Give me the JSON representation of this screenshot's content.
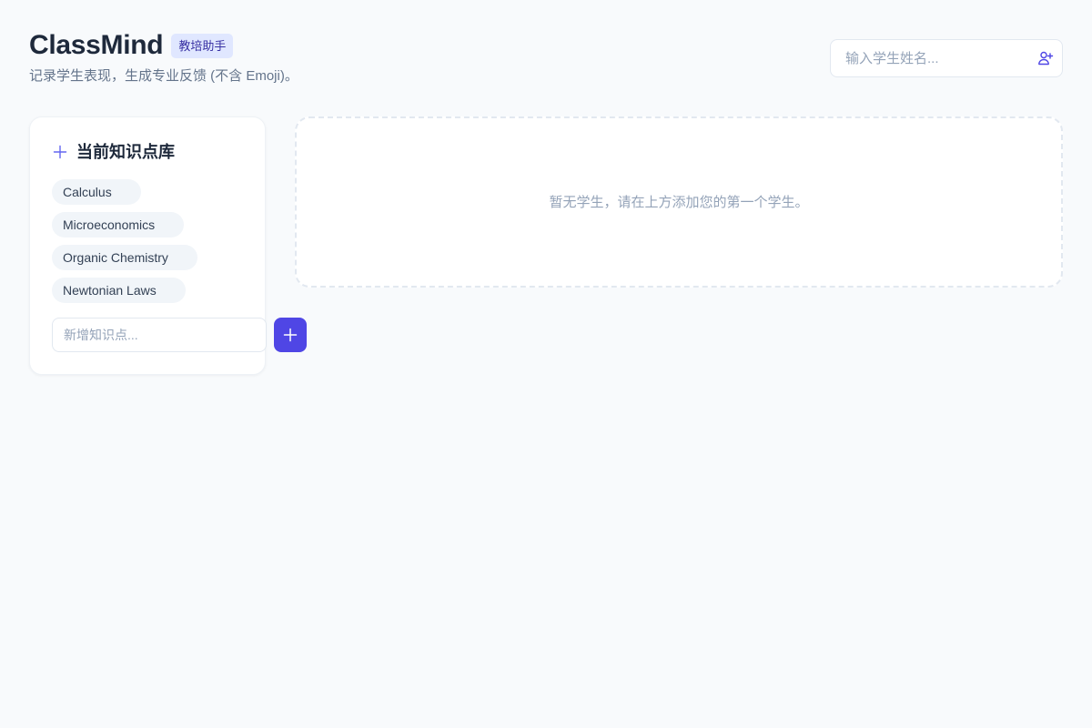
{
  "header": {
    "app_title": "ClassMind",
    "badge": "教培助手",
    "subtitle": "记录学生表现，生成专业反馈 (不含 Emoji)。",
    "student_input": {
      "value": "",
      "placeholder": "输入学生姓名..."
    },
    "add_user_icon": "user-plus-icon"
  },
  "knowledge_panel": {
    "icon": "plus-icon",
    "title": "当前知识点库",
    "topics": [
      {
        "label": "Calculus"
      },
      {
        "label": "Microeconomics"
      },
      {
        "label": "Organic Chemistry"
      },
      {
        "label": "Newtonian Laws"
      }
    ],
    "new_topic_input": {
      "value": "",
      "placeholder": "新增知识点..."
    },
    "add_icon": "plus-icon"
  },
  "students_panel": {
    "empty_message": "暂无学生，请在上方添加您的第一个学生。"
  },
  "colors": {
    "accent": "#4f46e5",
    "badge_bg": "#e0e7ff",
    "badge_text": "#3730a3",
    "page_bg": "#f8fafc"
  }
}
